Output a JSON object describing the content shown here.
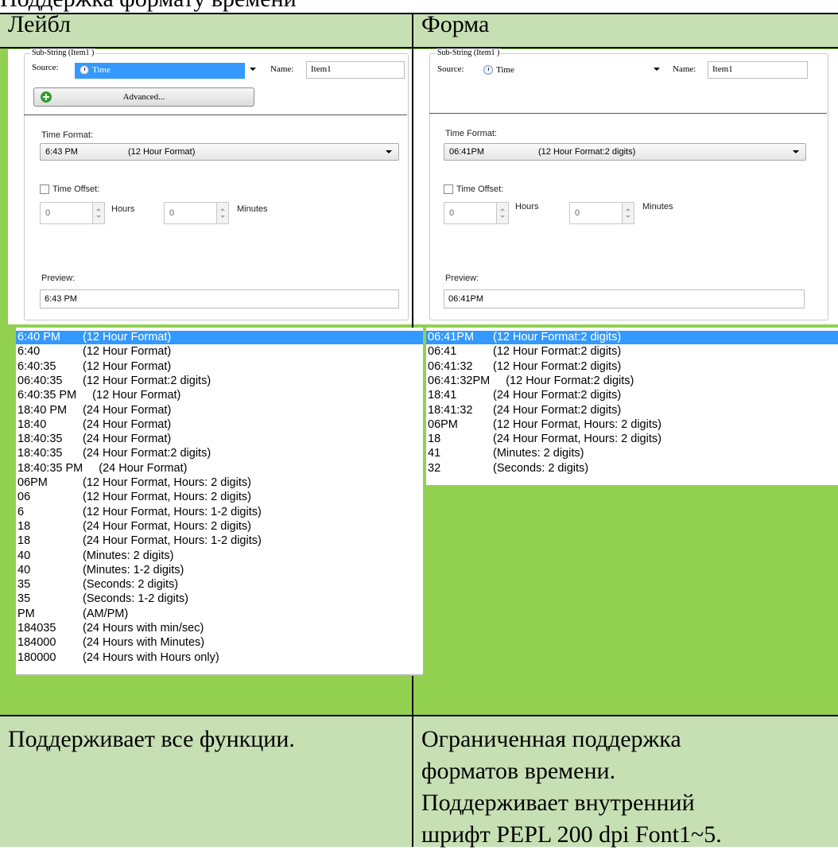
{
  "caption": "Поддержка формату времени",
  "columns": {
    "left_title": "Лейбл",
    "right_title": "Форма",
    "left_desc": "Поддерживает все функции.",
    "right_desc_lines": [
      "Ограниченная поддержка",
      "форматов времени.",
      "Поддерживает внутренний",
      "шрифт PEPL 200 dpi Font1~5."
    ]
  },
  "colors": {
    "cell_bg": "#c6e0b4",
    "list_area_bg": "#92d050",
    "selection": "#3399ff"
  },
  "left_dialog": {
    "group_title": "Sub-String (Item1 )",
    "source_label": "Source:",
    "source_value": "Time",
    "name_label": "Name:",
    "name_value": "Item1",
    "advanced_label": "Advanced...",
    "time_format_label": "Time Format:",
    "time_format_value": "6:43 PM",
    "time_format_desc": "(12 Hour Format)",
    "offset_label": "Time Offset:",
    "hours_value": "0",
    "hours_label": "Hours",
    "minutes_value": "0",
    "minutes_label": "Minutes",
    "preview_label": "Preview:",
    "preview_value": "6:43 PM"
  },
  "right_dialog": {
    "group_title": "Sub-String (Item1 )",
    "source_label": "Source:",
    "source_value": "Time",
    "name_label": "Name:",
    "name_value": "Item1",
    "time_format_label": "Time Format:",
    "time_format_value": "06:41PM",
    "time_format_desc": "(12 Hour Format:2 digits)",
    "offset_label": "Time Offset:",
    "hours_value": "0",
    "hours_label": "Hours",
    "minutes_value": "0",
    "minutes_label": "Minutes",
    "preview_label": "Preview:",
    "preview_value": "06:41PM"
  },
  "left_formats": [
    {
      "value": "6:40 PM",
      "desc": "(12 Hour Format)",
      "selected": true
    },
    {
      "value": "6:40",
      "desc": "(12 Hour Format)"
    },
    {
      "value": "6:40:35",
      "desc": "(12 Hour Format)"
    },
    {
      "value": "06:40:35",
      "desc": "(12 Hour Format:2 digits)"
    },
    {
      "value": "6:40:35 PM",
      "desc": "(12 Hour Format)"
    },
    {
      "value": "18:40 PM",
      "desc": "(24 Hour Format)"
    },
    {
      "value": "18:40",
      "desc": "(24 Hour Format)"
    },
    {
      "value": "18:40:35",
      "desc": "(24 Hour Format)"
    },
    {
      "value": "18:40:35",
      "desc": "(24 Hour Format:2 digits)"
    },
    {
      "value": "18:40:35 PM",
      "desc": "(24 Hour Format)"
    },
    {
      "value": "06PM",
      "desc": "(12 Hour Format, Hours: 2 digits)"
    },
    {
      "value": "06",
      "desc": "(12 Hour Format, Hours: 2 digits)"
    },
    {
      "value": "6",
      "desc": "(12 Hour Format, Hours: 1-2 digits)"
    },
    {
      "value": "18",
      "desc": "(24 Hour Format, Hours: 2 digits)"
    },
    {
      "value": "18",
      "desc": "(24 Hour Format, Hours: 1-2 digits)"
    },
    {
      "value": "40",
      "desc": "(Minutes: 2 digits)"
    },
    {
      "value": "40",
      "desc": "(Minutes: 1-2 digits)"
    },
    {
      "value": "35",
      "desc": "(Seconds: 2 digits)"
    },
    {
      "value": "35",
      "desc": "(Seconds: 1-2 digits)"
    },
    {
      "value": "PM",
      "desc": "(AM/PM)"
    },
    {
      "value": "184035",
      "desc": "(24 Hours with min/sec)"
    },
    {
      "value": "184000",
      "desc": "(24 Hours with Minutes)"
    },
    {
      "value": "180000",
      "desc": "(24 Hours with Hours only)"
    }
  ],
  "right_formats": [
    {
      "value": "06:41PM",
      "desc": "(12 Hour Format:2 digits)",
      "selected": true
    },
    {
      "value": "06:41",
      "desc": "(12 Hour Format:2 digits)"
    },
    {
      "value": "06:41:32",
      "desc": "(12 Hour Format:2 digits)"
    },
    {
      "value": "06:41:32PM",
      "desc": "(12 Hour Format:2 digits)"
    },
    {
      "value": "18:41",
      "desc": "(24 Hour Format:2 digits)"
    },
    {
      "value": "18:41:32",
      "desc": "(24 Hour Format:2 digits)"
    },
    {
      "value": "06PM",
      "desc": "(12 Hour Format, Hours: 2 digits)"
    },
    {
      "value": "18",
      "desc": "(24 Hour Format, Hours: 2 digits)"
    },
    {
      "value": "41",
      "desc": "(Minutes: 2 digits)"
    },
    {
      "value": "32",
      "desc": "(Seconds: 2 digits)"
    }
  ]
}
